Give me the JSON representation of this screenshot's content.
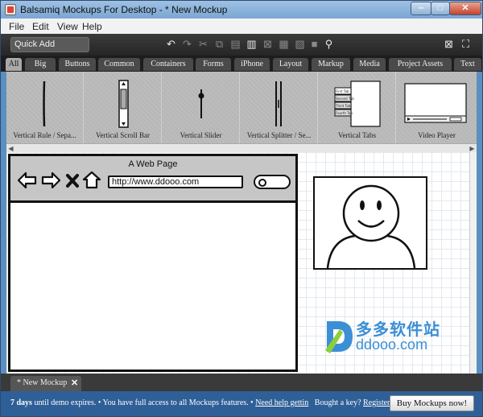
{
  "window": {
    "title": "Balsamiq Mockups For Desktop - * New Mockup",
    "min_glyph": "–",
    "max_glyph": "□",
    "close_glyph": "✕"
  },
  "menu": [
    "File",
    "Edit",
    "View",
    "Help"
  ],
  "toolbar": {
    "quick_add": "Quick Add",
    "icons": [
      "undo-icon",
      "redo-icon",
      "cut-icon",
      "copy-icon",
      "paste-icon",
      "delete-icon",
      "group-icon",
      "lock-icon",
      "search-icon"
    ],
    "right_icons": [
      "close-mockup-icon",
      "fullscreen-icon"
    ]
  },
  "categories": [
    "All",
    "Big",
    "Buttons",
    "Common",
    "Containers",
    "Forms",
    "iPhone",
    "Layout",
    "Markup",
    "Media",
    "Project Assets",
    "Text"
  ],
  "library": [
    {
      "label": "Vertical Rule / Sepa...",
      "icon": "vertical-rule-icon"
    },
    {
      "label": "Vertical Scroll Bar",
      "icon": "vertical-scrollbar-icon"
    },
    {
      "label": "Vertical Slider",
      "icon": "vertical-slider-icon"
    },
    {
      "label": "Vertical Splitter / Se...",
      "icon": "vertical-splitter-icon"
    },
    {
      "label": "Vertical Tabs",
      "icon": "vertical-tabs-icon",
      "tabs": [
        "First Tab",
        "Second Tab",
        "Third Tab",
        "Fourth Tab"
      ]
    },
    {
      "label": "Video Player",
      "icon": "video-player-icon"
    }
  ],
  "canvas": {
    "browser_title": "A Web Page",
    "url": "http://www.ddooo.com",
    "watermark_cn": "多多软件站",
    "watermark_en": "ddooo.com"
  },
  "doc_tab": {
    "label": "* New Mockup",
    "close": "✕"
  },
  "status": {
    "days": "7 days",
    "until": " until demo expires. • You have full access to all Mockups features. • ",
    "help_link": "Need help gettin",
    "buy_q": "   Bought a key? ",
    "register": "Register...",
    "buy_button": "Buy Mockups now!"
  },
  "colors": {
    "accent": "#3c8fd5",
    "status_bar": "#2f5f97",
    "toolbar": "#2e2e2e"
  }
}
